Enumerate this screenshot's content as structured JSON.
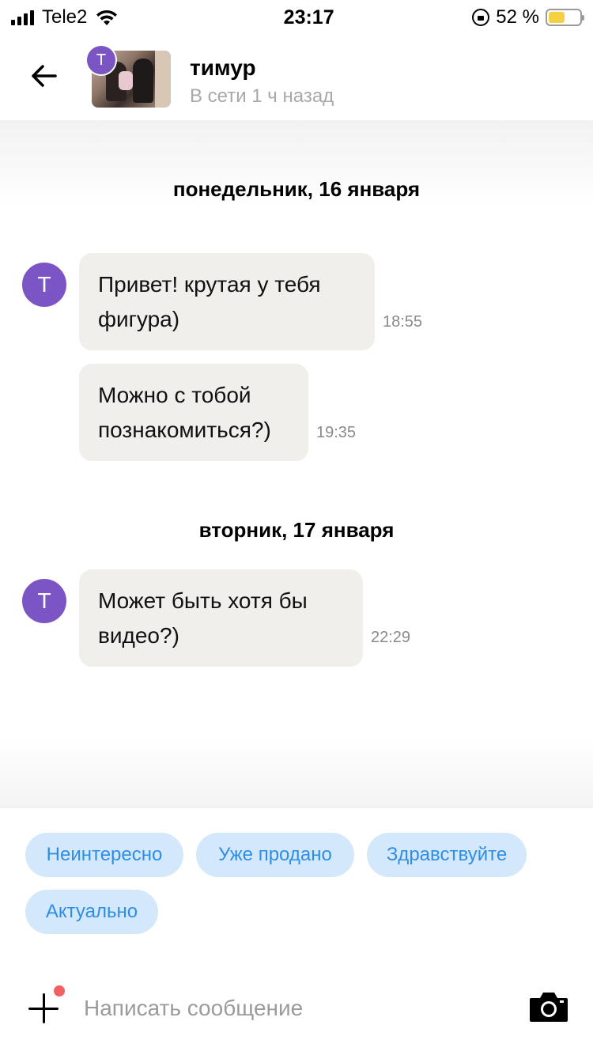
{
  "status_bar": {
    "carrier": "Tele2",
    "time": "23:17",
    "battery": "52 %",
    "battery_level": 0.52,
    "battery_color": "#f6d043"
  },
  "header": {
    "back_icon": "arrow-left-icon",
    "avatar_letter": "T",
    "name": "тимур",
    "status": "В сети 1 ч назад"
  },
  "chat": {
    "days": [
      {
        "label": "понедельник, 16 января",
        "messages": [
          {
            "avatar": "T",
            "line1": "Привет! крутая у тебя",
            "line2": "фигура)",
            "time": "18:55"
          },
          {
            "line1": "Можно с тобой",
            "line2": "познакомиться?)",
            "time": "19:35"
          }
        ]
      },
      {
        "label": "вторник, 17 января",
        "messages": [
          {
            "avatar": "T",
            "line1": "Может быть хотя бы",
            "line2": "видео?)",
            "time": "22:29"
          }
        ]
      }
    ]
  },
  "quick_replies": [
    "Неинтересно",
    "Уже продано",
    "Здравствуйте",
    "Актуально"
  ],
  "composer": {
    "placeholder": "Написать сообщение",
    "plus_icon": "plus-icon",
    "camera_icon": "camera-icon",
    "notification_dot_color": "#f16161"
  },
  "colors": {
    "avatar": "#7b55c4",
    "bubble": "#f0efeb",
    "chip_bg": "#d3e8fb",
    "chip_text": "#2e8ee6"
  }
}
